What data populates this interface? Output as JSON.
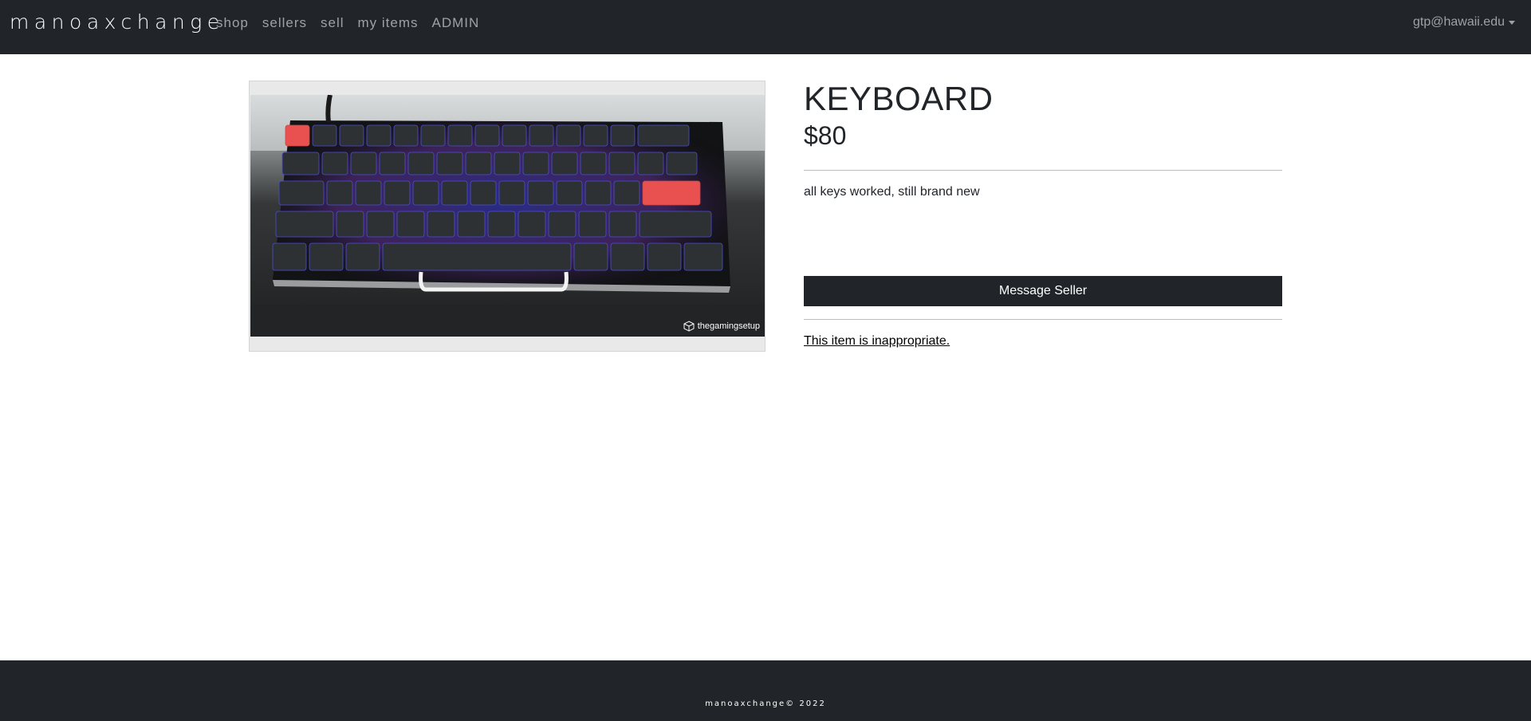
{
  "nav": {
    "brand": "manoaxchange",
    "links": [
      "shop",
      "sellers",
      "sell",
      "my items",
      "ADMIN"
    ],
    "user": "gtp@hawaii.edu"
  },
  "item": {
    "title": "KEYBOARD",
    "price": "$80",
    "description": "all keys worked, still brand new",
    "image_watermark": "thegamingsetup"
  },
  "actions": {
    "message_seller": "Message Seller",
    "report": "This item is inappropriate."
  },
  "footer": {
    "text": "manoaxchange© 2022"
  },
  "colors": {
    "navbar": "#212529",
    "nav_link": "#9ea2a6",
    "button": "#212529",
    "accent_key": "#e8514f"
  }
}
